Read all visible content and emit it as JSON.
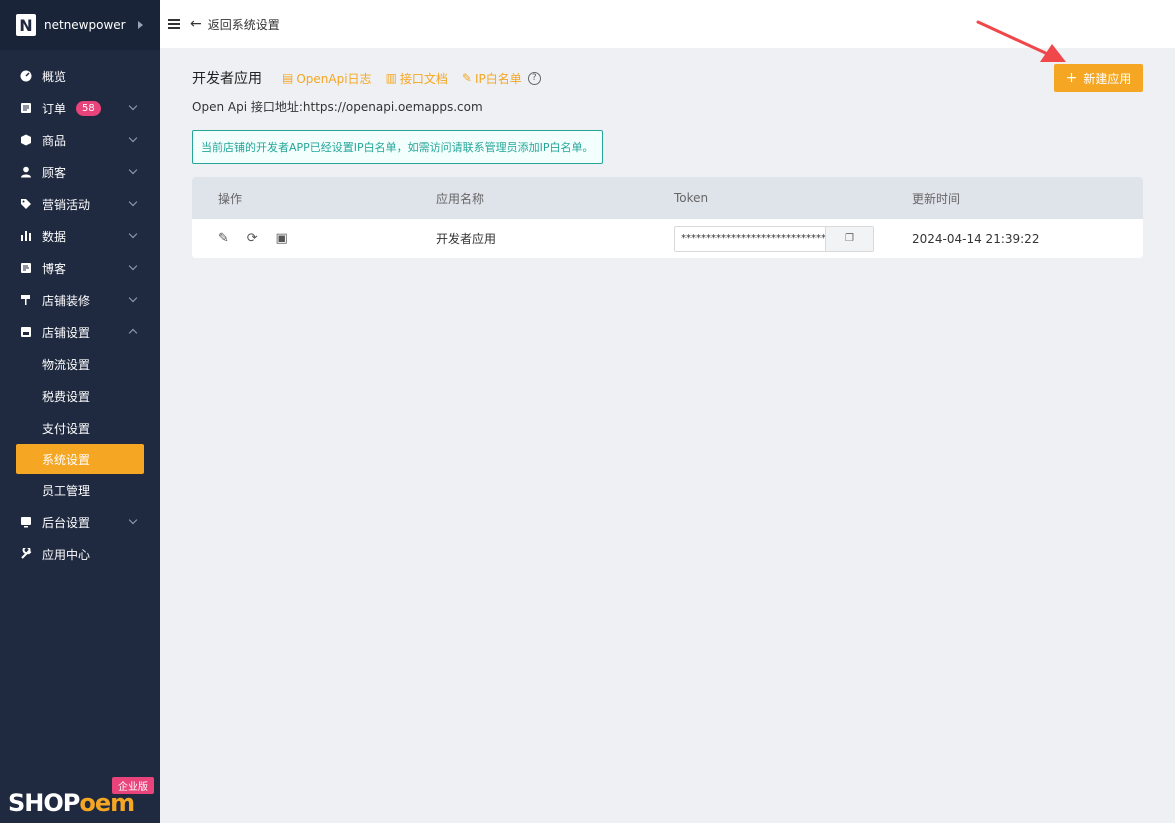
{
  "brand": {
    "letter": "N",
    "name": "netnewpower"
  },
  "menu": [
    {
      "label": "概览",
      "icon": "dashboard-icon",
      "expandable": false
    },
    {
      "label": "订单",
      "icon": "order-icon",
      "expandable": true,
      "badge": "58"
    },
    {
      "label": "商品",
      "icon": "product-icon",
      "expandable": true
    },
    {
      "label": "顾客",
      "icon": "user-icon",
      "expandable": true
    },
    {
      "label": "营销活动",
      "icon": "tag-icon",
      "expandable": true
    },
    {
      "label": "数据",
      "icon": "chart-icon",
      "expandable": true
    },
    {
      "label": "博客",
      "icon": "blog-icon",
      "expandable": true
    },
    {
      "label": "店铺装修",
      "icon": "paint-roller-icon",
      "expandable": true
    },
    {
      "label": "店铺设置",
      "icon": "store-icon",
      "expandable": true,
      "expanded": true
    }
  ],
  "submenu": [
    "物流设置",
    "税费设置",
    "支付设置",
    "系统设置",
    "员工管理"
  ],
  "submenu_active": "系统设置",
  "menu_after": [
    {
      "label": "后台设置",
      "icon": "monitor-icon",
      "expandable": true
    },
    {
      "label": "应用中心",
      "icon": "wrench-icon",
      "expandable": false
    }
  ],
  "logo": {
    "shop": "SHOP",
    "oem": "oem",
    "badge": "企业版"
  },
  "topbar": {
    "back_label": "返回系统设置"
  },
  "page": {
    "title": "开发者应用",
    "links": [
      {
        "label": "OpenApi日志",
        "icon": "log-icon"
      },
      {
        "label": "接口文档",
        "icon": "doc-icon"
      },
      {
        "label": "IP白名单",
        "icon": "pencil-icon"
      }
    ],
    "new_button": "新建应用",
    "api_address": "Open Api 接口地址:https://openapi.oemapps.com",
    "notice": "当前店铺的开发者APP已经设置IP白名单，如需访问请联系管理员添加IP白名单。"
  },
  "table": {
    "headers": [
      "操作",
      "应用名称",
      "Token",
      "更新时间"
    ],
    "rows": [
      {
        "name": "开发者应用",
        "token": "*****************************",
        "updated": "2024-04-14 21:39:22"
      }
    ]
  },
  "colors": {
    "accent": "#f5a623",
    "sidebar": "#1f2a40",
    "notice": "#26a69a",
    "badge": "#e8437a",
    "arrow": "#f0474a"
  }
}
